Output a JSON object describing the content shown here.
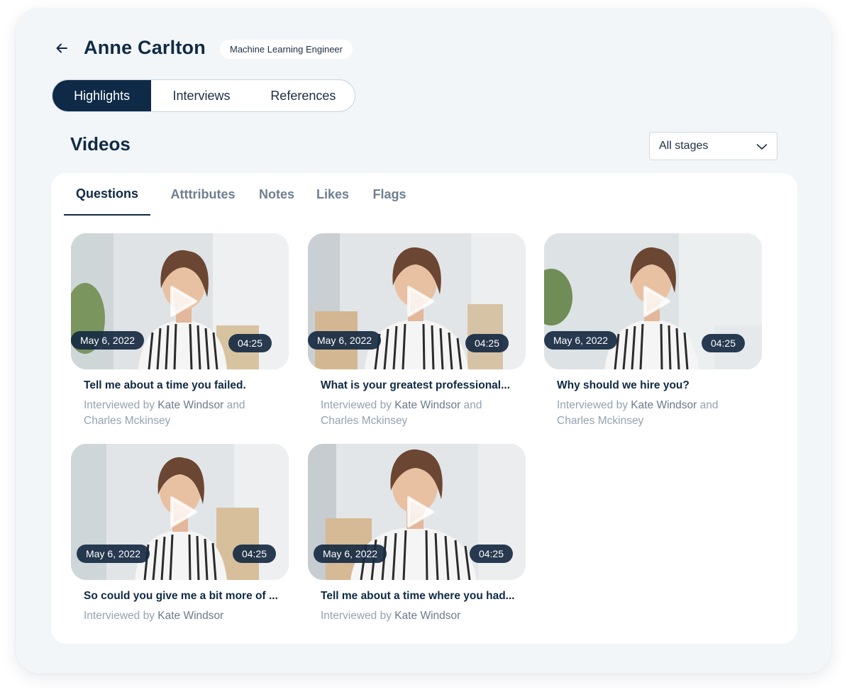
{
  "header": {
    "name": "Anne Carlton",
    "role": "Machine Learning Engineer"
  },
  "segments": [
    {
      "label": "Highlights",
      "active": true
    },
    {
      "label": "Interviews",
      "active": false
    },
    {
      "label": "References",
      "active": false
    }
  ],
  "section": {
    "title": "Videos",
    "stage_filter": "All stages"
  },
  "tabs": [
    {
      "label": "Questions",
      "active": true
    },
    {
      "label": "Atttributes",
      "active": false
    },
    {
      "label": "Notes",
      "active": false
    },
    {
      "label": "Likes",
      "active": false
    },
    {
      "label": "Flags",
      "active": false
    }
  ],
  "videos": [
    {
      "date": "May 6, 2022",
      "duration": "04:25",
      "title": "Tell me about a time you failed.",
      "prefix": "Interviewed by",
      "interviewer1": "Kate Windsor",
      "joiner": "and",
      "interviewer2": "Charles Mckinsey"
    },
    {
      "date": "May 6, 2022",
      "duration": "04:25",
      "title": "What is your greatest professional...",
      "prefix": "Interviewed by",
      "interviewer1": "Kate Windsor",
      "joiner": "and",
      "interviewer2": "Charles Mckinsey"
    },
    {
      "date": "May 6, 2022",
      "duration": "04:25",
      "title": "Why should we hire you?",
      "prefix": "Interviewed by",
      "interviewer1": "Kate Windsor",
      "joiner": "and",
      "interviewer2": "Charles Mckinsey"
    },
    {
      "date": "May 6, 2022",
      "duration": "04:25",
      "title": "So could you give me a bit more of ...",
      "prefix": "Interviewed by",
      "interviewer1": "Kate Windsor"
    },
    {
      "date": "May 6, 2022",
      "duration": "04:25",
      "title": "Tell me about a time where you had...",
      "prefix": "Interviewed by",
      "interviewer1": "Kate Windsor"
    }
  ],
  "icons": {
    "back": "arrow-left-icon",
    "dropdown": "chevron-down-icon",
    "play": "play-icon"
  },
  "colors": {
    "accent": "#0e2a47",
    "text_muted": "#94a3b3",
    "background": "#f3f6f9"
  }
}
